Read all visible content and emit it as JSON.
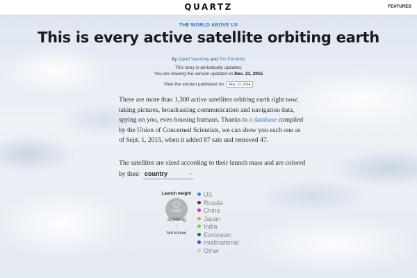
{
  "header": {
    "logo": "QUARTZ",
    "featured_label": "FEATURED"
  },
  "article": {
    "kicker": "THE WORLD ABOVE US",
    "headline": "This is every active satellite orbiting earth",
    "byline": {
      "prefix": "By",
      "author1": "David Yanofsky",
      "and": "and",
      "author2": "Tim Fernholz"
    },
    "update_note": "This story is periodically updated.",
    "version_note_prefix": "You are viewing the version updated on",
    "version_date": "Dec. 21, 2015",
    "view_version_label": "View the version published on",
    "version_select_value": "Nov. 17, 2014",
    "paragraph1_before_link": "There are more than 1,300 active satellites orbiting earth right now, taking pictures, broadcasting communication and navigation data, spying on you, even housing humans. Thanks to",
    "paragraph1_link": "a database",
    "paragraph1_after_link": "compiled by the Union of Concerned Scientists, we can show you each one as of Sept. 1, 2015, when it added 87 sats and removed 47.",
    "paragraph2": "The satellites are sized according to their launch mass and are colored by their",
    "color_select_value": "country",
    "color_select_chevron": "⌄"
  },
  "size_legend": {
    "title": "Launch weight",
    "small_label": "5,000",
    "large_label": "20,000 kg",
    "plus_symbol": "+",
    "unknown_label": "Not known"
  },
  "color_legend": [
    {
      "label": "US",
      "color": "#3a86c8"
    },
    {
      "label": "Russia",
      "color": "#8a1538"
    },
    {
      "label": "China",
      "color": "#c43aa6"
    },
    {
      "label": "Japan",
      "color": "#e8a13a"
    },
    {
      "label": "India",
      "color": "#8cc63f"
    },
    {
      "label": "European",
      "color": "#1f6b3a"
    },
    {
      "label": "multinational",
      "color": "#6a3d9a"
    },
    {
      "label": "Other",
      "color": "#c8c8c8"
    }
  ]
}
